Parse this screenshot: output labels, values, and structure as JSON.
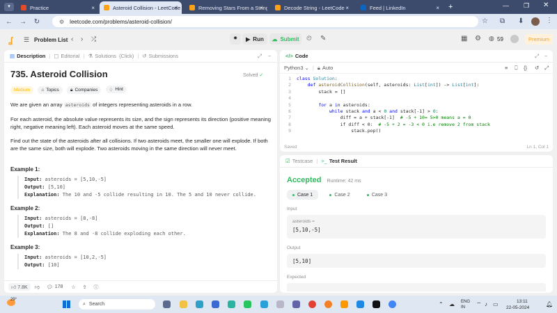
{
  "browser": {
    "tabs": [
      {
        "title": "Practice",
        "active": false
      },
      {
        "title": "Asteroid Collision - LeetCode",
        "active": true
      },
      {
        "title": "Removing Stars From a String",
        "active": false
      },
      {
        "title": "Decode String - LeetCode",
        "active": false
      },
      {
        "title": "Feed | LinkedIn",
        "active": false
      }
    ],
    "url": "leetcode.com/problems/asteroid-collision/"
  },
  "toolbar": {
    "problem_list": "Problem List",
    "run": "Run",
    "submit": "Submit",
    "streak": "59",
    "premium": "Premium"
  },
  "left_tabs": {
    "description": "Description",
    "editorial": "Editorial",
    "solutions": "Solutions",
    "click": "(Click)",
    "submissions": "Submissions"
  },
  "problem": {
    "title": "735. Asteroid Collision",
    "status": "Solved",
    "difficulty": "Medium",
    "topics": "Topics",
    "companies": "Companies",
    "hint": "Hint",
    "p1_before": "We are given an array",
    "p1_code": "asteroids",
    "p1_after": "of integers representing asteroids in a row.",
    "p2": "For each asteroid, the absolute value represents its size, and the sign represents its direction (positive meaning right, negative meaning left). Each asteroid moves at the same speed.",
    "p3": "Find out the state of the asteroids after all collisions. If two asteroids meet, the smaller one will explode. If both are the same size, both will explode. Two asteroids moving in the same direction will never meet.",
    "examples": [
      {
        "title": "Example 1:",
        "input": "asteroids = [5,10,-5]",
        "output": "[5,10]",
        "explanation": "The 10 and -5 collide resulting in 10. The 5 and 10 never collide."
      },
      {
        "title": "Example 2:",
        "input": "asteroids = [8,-8]",
        "output": "[]",
        "explanation": "The 8 and -8 collide exploding each other."
      },
      {
        "title": "Example 3:",
        "input": "asteroids = [10,2,-5]",
        "output": "[10]"
      }
    ],
    "labels": {
      "input": "Input:",
      "output": "Output:",
      "explanation": "Explanation:"
    },
    "likes": "7.8K",
    "comments": "178"
  },
  "code": {
    "header": "Code",
    "language": "Python3",
    "auto": "Auto",
    "lines": [
      "class Solution:",
      "    def asteroidCollision(self, asteroids: List[int]) -> List[int]:",
      "        stack = []",
      "",
      "        for a in asteroids:",
      "            while stack and a < 0 and stack[-1] > 0:",
      "                diff = a + stack[-1]  # -5 + 10= 5>0 means a = 0",
      "                if diff < 0:  # -5 + 2 = -3 < 0 i.e remove 2 from stack",
      "                    stack.pop()"
    ],
    "saved": "Saved",
    "position": "Ln 1, Col 1"
  },
  "result": {
    "testcase_tab": "Testcase",
    "result_tab": "Test Result",
    "verdict": "Accepted",
    "runtime": "Runtime: 42 ms",
    "cases": [
      "Case 1",
      "Case 2",
      "Case 3"
    ],
    "input_label": "Input",
    "var_name": "asteroids =",
    "var_value": "[5,10,-5]",
    "output_label": "Output",
    "output_value": "[5,10]",
    "expected_label": "Expected"
  },
  "taskbar": {
    "weather": "29°",
    "search": "Search",
    "lang1": "ENG",
    "lang2": "IN",
    "time": "13:11",
    "date": "22-05-2024"
  },
  "colors": {
    "accent_green": "#2cbb5d",
    "medium": "#ffb800",
    "premium": "#ffa116"
  }
}
